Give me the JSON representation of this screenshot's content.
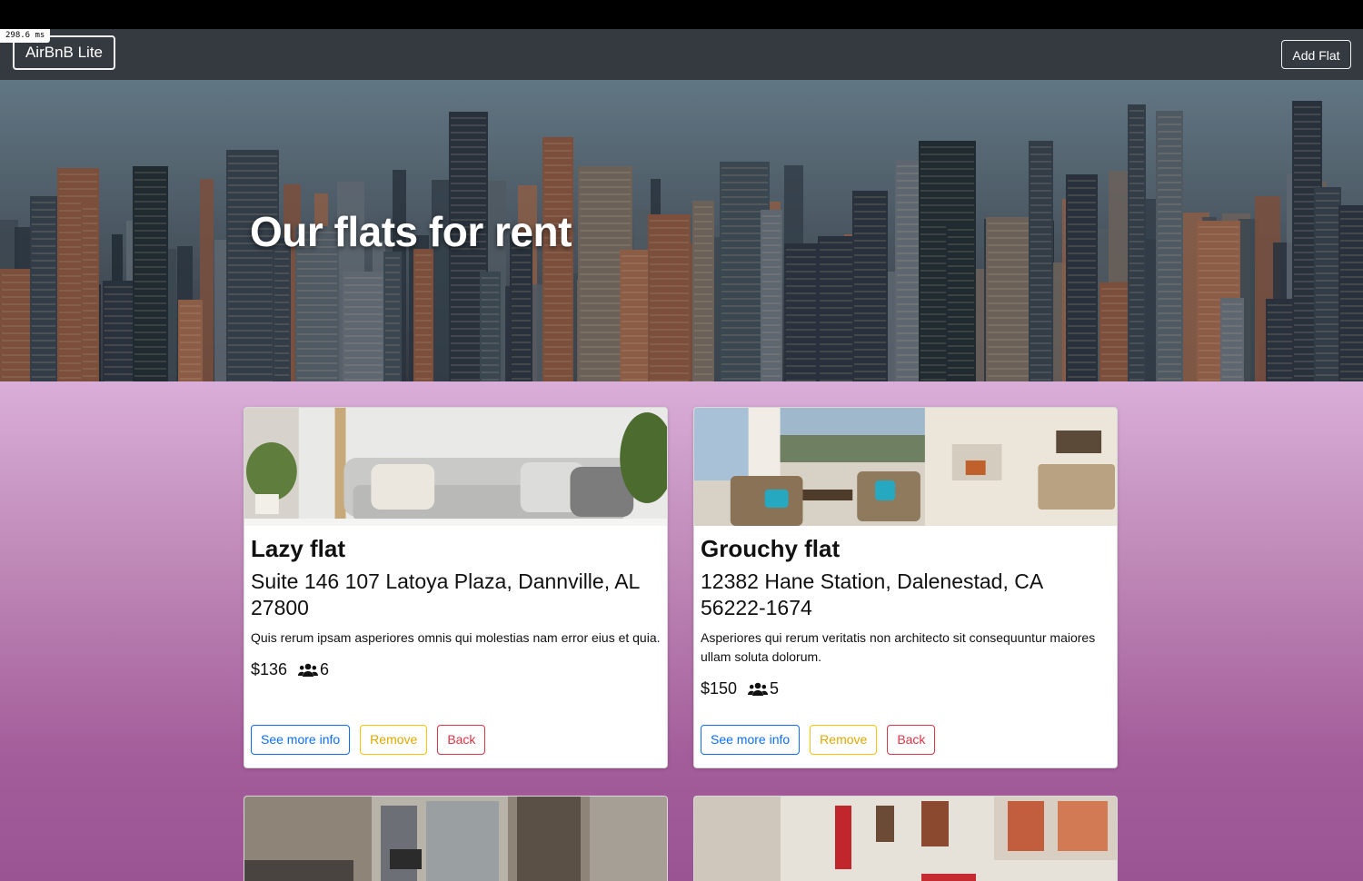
{
  "debug": {
    "timer": "298.6 ms"
  },
  "navbar": {
    "brand": "AirBnB Lite",
    "add_flat_label": "Add Flat"
  },
  "hero": {
    "title": "Our flats for rent"
  },
  "flats": [
    {
      "title": "Lazy flat",
      "address": "Suite 146 107 Latoya Plaza, Dannville, AL 27800",
      "description": "Quis rerum ipsam asperiores omnis qui molestias nam error eius et quia.",
      "price": "$136",
      "guests": "6",
      "buttons": {
        "info": "See more info",
        "remove": "Remove",
        "back": "Back"
      }
    },
    {
      "title": "Grouchy flat",
      "address": "12382 Hane Station, Dalenestad, CA 56222-1674",
      "description": "Asperiores qui rerum veritatis non architecto sit consequuntur maiores ullam soluta dolorum.",
      "price": "$150",
      "guests": "5",
      "buttons": {
        "info": "See more info",
        "remove": "Remove",
        "back": "Back"
      }
    }
  ],
  "icons": {
    "guests": "users-icon"
  },
  "colors": {
    "navbar": "#343a40",
    "info_button": "#0d6efd",
    "remove_button": "#ffc107",
    "back_button": "#dc3545",
    "background_top": "#d9aed8",
    "background_bottom": "#9a5494"
  }
}
